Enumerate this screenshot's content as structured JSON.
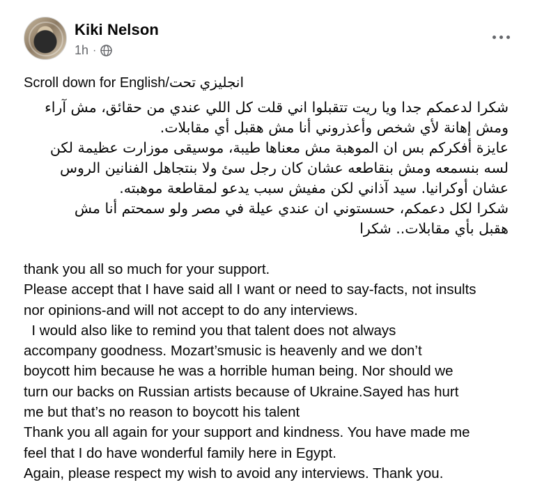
{
  "post": {
    "author": "Kiki Nelson",
    "time": "1h",
    "separator": "·",
    "heading": "Scroll down for English/انجليزي تحت",
    "arabic_lines": [
      "شكرا لدعمكم جدا ويا ريت تتقبلوا اني قلت كل اللي عندي من حقائق، مش آراء",
      "ومش إهانة لأي شخص وأعذروني أنا مش هقبل أي مقابلات.",
      "عايزة أفكركم بس ان الموهبة مش معناها طيبة، موسيقى موزارت عظيمة لكن",
      "لسه بنسمعه ومش بنقاطعه عشان كان رجل سئ ولا بنتجاهل الفنانين الروس",
      "عشان أوكرانيا. سيد آذاني لكن مفيش سبب يدعو لمقاطعة موهبته.",
      "شكرا لكل دعمكم، حسستوني ان عندي عيلة في مصر ولو سمحتم أنا مش",
      "هقبل بأي مقابلات.. شكرا"
    ],
    "english_lines": [
      "thank you all so much for your support.",
      "Please accept that I have said all I want or need to say-facts, not insults",
      "nor opinions-and will not accept to do any interviews.",
      "  I would also like to remind you that talent does not always",
      "accompany goodness. Mozart’smusic is heavenly and we don’t",
      "boycott him because he was a horrible human being. Nor should we",
      "turn our backs on Russian artists because of Ukraine.Sayed has hurt",
      "me but that’s no reason to boycott his talent",
      "Thank you all again for your support and kindness. You have made me",
      "feel that I do have wonderful family here in Egypt.",
      "Again, please respect my wish to avoid any interviews. Thank you."
    ]
  },
  "icons": {
    "privacy": "globe-icon",
    "options": "more-options-icon",
    "avatar": "profile-avatar"
  },
  "colors": {
    "text": "#050505",
    "meta": "#65676b",
    "background": "#ffffff"
  }
}
